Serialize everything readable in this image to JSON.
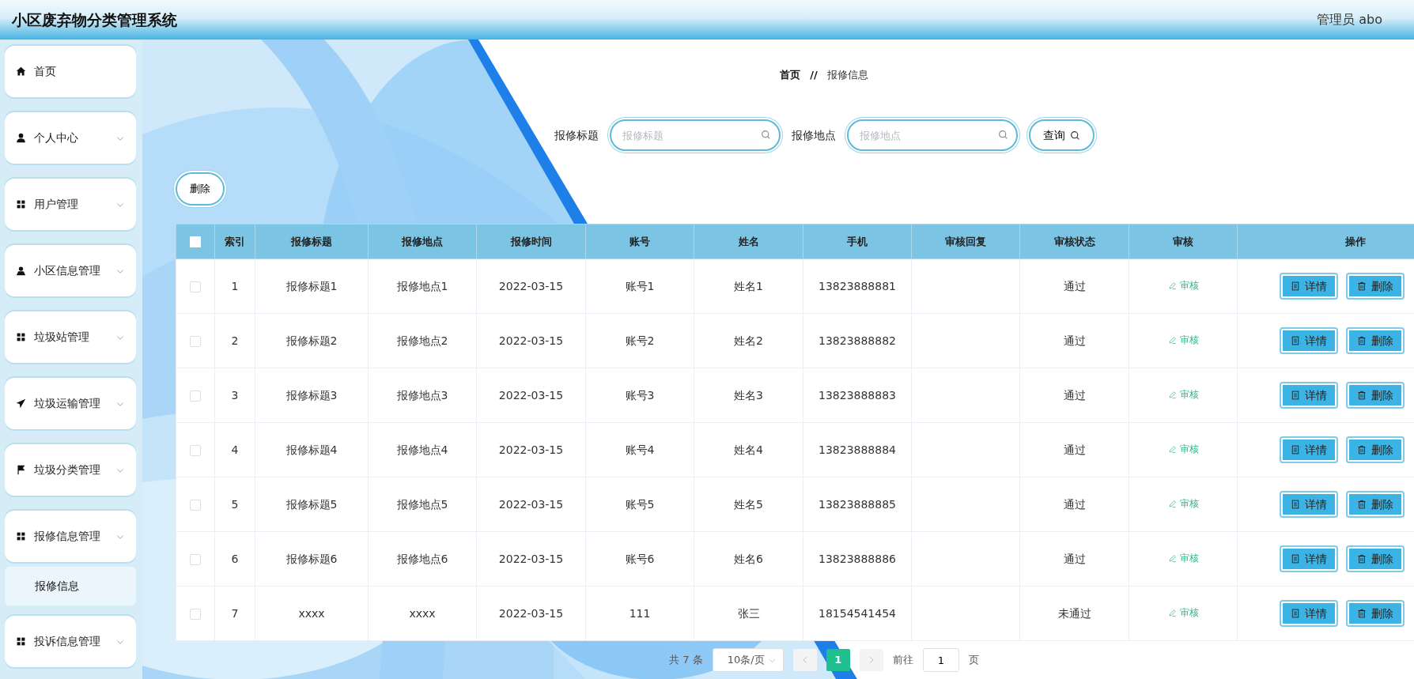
{
  "header": {
    "title": "小区废弃物分类管理系统",
    "user": "管理员 abo"
  },
  "sidebar": {
    "items": [
      {
        "label": "首页",
        "kind": "home"
      },
      {
        "label": "个人中心",
        "kind": "user"
      },
      {
        "label": "用户管理",
        "kind": "grid"
      },
      {
        "label": "小区信息管理",
        "kind": "person"
      },
      {
        "label": "垃圾站管理",
        "kind": "grid"
      },
      {
        "label": "垃圾运输管理",
        "kind": "plane"
      },
      {
        "label": "垃圾分类管理",
        "kind": "flag"
      },
      {
        "label": "报修信息管理",
        "kind": "grid",
        "children": [
          {
            "label": "报修信息",
            "selected": true
          }
        ]
      },
      {
        "label": "投诉信息管理",
        "kind": "grid"
      }
    ]
  },
  "breadcrumb": [
    "首页",
    "报修信息"
  ],
  "breadcrumb_separator": "//",
  "search": {
    "fields": [
      {
        "label": "报修标题",
        "placeholder": "报修标题"
      },
      {
        "label": "报修地点",
        "placeholder": "报修地点"
      }
    ],
    "button": "查询"
  },
  "delete_button": "删除",
  "table": {
    "select_all": {
      "checked": false
    },
    "columns": [
      "索引",
      "报修标题",
      "报修地点",
      "报修时间",
      "账号",
      "姓名",
      "手机",
      "审核回复",
      "审核状态",
      "审核",
      "操作"
    ],
    "rows": [
      {
        "checked": false,
        "cells": [
          "1",
          "报修标题1",
          "报修地点1",
          "2022-03-15",
          "账号1",
          "姓名1",
          "13823888881",
          "",
          "通过"
        ],
        "review": "审核",
        "details": "详情",
        "delete": "删除"
      },
      {
        "checked": false,
        "cells": [
          "2",
          "报修标题2",
          "报修地点2",
          "2022-03-15",
          "账号2",
          "姓名2",
          "13823888882",
          "",
          "通过"
        ],
        "review": "审核",
        "details": "详情",
        "delete": "删除"
      },
      {
        "checked": false,
        "cells": [
          "3",
          "报修标题3",
          "报修地点3",
          "2022-03-15",
          "账号3",
          "姓名3",
          "13823888883",
          "",
          "通过"
        ],
        "review": "审核",
        "details": "详情",
        "delete": "删除"
      },
      {
        "checked": false,
        "cells": [
          "4",
          "报修标题4",
          "报修地点4",
          "2022-03-15",
          "账号4",
          "姓名4",
          "13823888884",
          "",
          "通过"
        ],
        "review": "审核",
        "details": "详情",
        "delete": "删除"
      },
      {
        "checked": false,
        "cells": [
          "5",
          "报修标题5",
          "报修地点5",
          "2022-03-15",
          "账号5",
          "姓名5",
          "13823888885",
          "",
          "通过"
        ],
        "review": "审核",
        "details": "详情",
        "delete": "删除"
      },
      {
        "checked": false,
        "cells": [
          "6",
          "报修标题6",
          "报修地点6",
          "2022-03-15",
          "账号6",
          "姓名6",
          "13823888886",
          "",
          "通过"
        ],
        "review": "审核",
        "details": "详情",
        "delete": "删除"
      },
      {
        "checked": false,
        "cells": [
          "7",
          "xxxx",
          "xxxx",
          "2022-03-15",
          "111",
          "张三",
          "18154541454",
          "",
          "未通过"
        ],
        "review": "审核",
        "details": "详情",
        "delete": "删除"
      }
    ]
  },
  "pagination": {
    "total": "共 7 条",
    "page_size": "10条/页",
    "pages": [
      {
        "label": "1",
        "selected": true
      }
    ],
    "goto_label": "前往",
    "goto_value": "1",
    "goto_suffix": "页"
  }
}
